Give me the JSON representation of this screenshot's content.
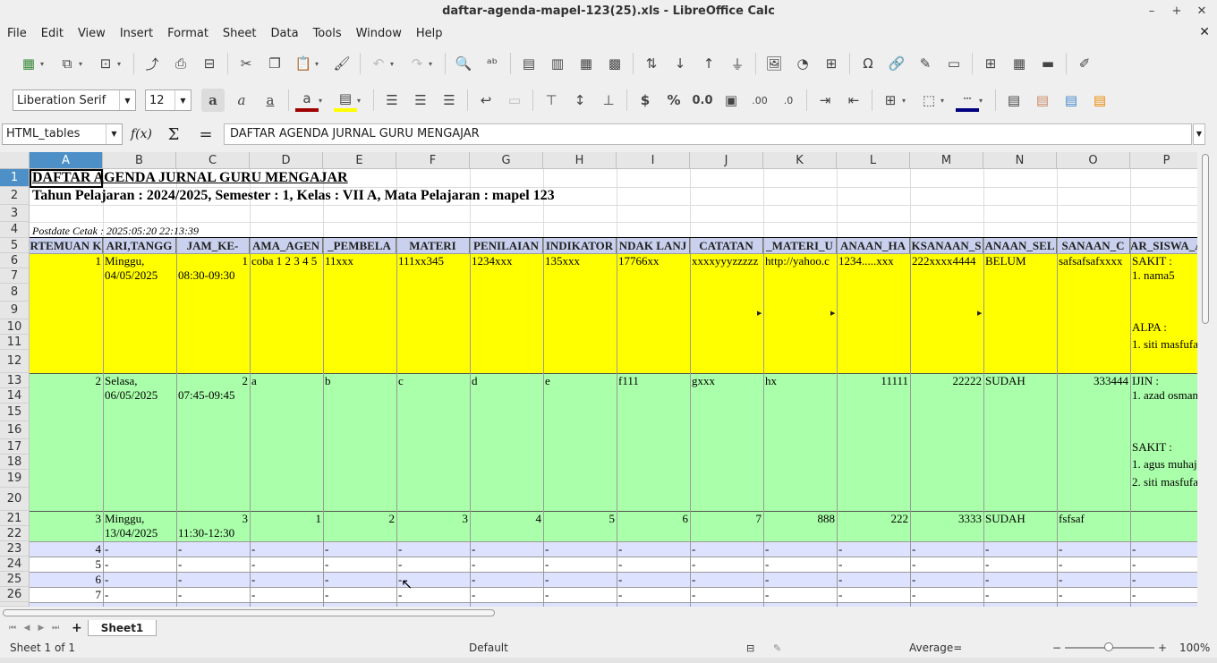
{
  "window": {
    "title": "daftar-agenda-mapel-123(25).xls - LibreOffice Calc"
  },
  "menu": [
    "File",
    "Edit",
    "View",
    "Insert",
    "Format",
    "Sheet",
    "Data",
    "Tools",
    "Window",
    "Help"
  ],
  "format": {
    "font_name": "Liberation Serif",
    "font_size": "12"
  },
  "formula_bar": {
    "name_box": "HTML_tables",
    "content": "DAFTAR AGENDA JURNAL GURU MENGAJAR"
  },
  "columns": [
    "A",
    "B",
    "C",
    "D",
    "E",
    "F",
    "G",
    "H",
    "I",
    "J",
    "K",
    "L",
    "M",
    "N",
    "O",
    "P"
  ],
  "rows": [
    "1",
    "2",
    "3",
    "4",
    "5",
    "6",
    "7",
    "8",
    "9",
    "10",
    "11",
    "12",
    "13",
    "14",
    "15",
    "16",
    "17",
    "18",
    "19",
    "20",
    "21",
    "22",
    "23",
    "24",
    "25",
    "26"
  ],
  "sheet": {
    "title": "DAFTAR AGENDA JURNAL GURU MENGAJAR",
    "subtitle": "Tahun Pelajaran : 2024/2025, Semester : 1, Kelas : VII A, Mata Pelajaran : mapel 123",
    "postdate": "Postdate Cetak : 2025:05:20 22:13:39",
    "headers": [
      "RTEMUAN K",
      "ARI,TANGG",
      "JAM_KE-",
      "AMA_AGEN",
      "_PEMBELA",
      "MATERI",
      "PENILAIAN",
      "INDIKATOR",
      "NDAK LANJ",
      "CATATAN",
      "_MATERI_U",
      "ANAAN_HA",
      "KSANAAN_S",
      "ANAAN_SEL",
      "SANAAN_C",
      "AR_SISWA_A"
    ],
    "entry1": {
      "no": "1",
      "day": "Minggu,",
      "date": "04/05/2025",
      "jam": "1",
      "time": "08:30-09:30",
      "d": "coba 1 2 3 4 5",
      "e": "11xxx",
      "f": "111xx345",
      "g": "1234xxx",
      "h": "135xxx",
      "i": "17766xx",
      "j": "xxxxyyyzzzzz",
      "k": "http://yahoo.c",
      "l": "1234.....xxx",
      "m": "222xxxx4444",
      "n": "BELUM",
      "o": "safsafsafxxxx",
      "p1": "SAKIT :",
      "p2": "1. nama5",
      "p3": "ALPA :",
      "p4": "1. siti masfufa"
    },
    "entry2": {
      "no": "2",
      "day": "Selasa,",
      "date": "06/05/2025",
      "jam": "2",
      "time": "07:45-09:45",
      "d": "a",
      "e": "b",
      "f": "c",
      "g": "d",
      "h": "e",
      "i": "f111",
      "j": "gxxx",
      "k": "hx",
      "l": "11111",
      "m": "22222",
      "n": "SUDAH",
      "o": "333444",
      "p1": "IJIN :",
      "p2": "1. azad osman",
      "p3": "SAKIT :",
      "p4": "1. agus muhaj",
      "p5": "2. siti masfufa"
    },
    "entry3": {
      "no": "3",
      "day": "Minggu,",
      "date": "13/04/2025",
      "jam": "3",
      "time": "11:30-12:30",
      "d": "1",
      "e": "2",
      "f": "3",
      "g": "4",
      "h": "5",
      "i": "6",
      "j": "7",
      "k": "888",
      "l": "222",
      "m": "3333",
      "n": "SUDAH",
      "o": "fsfsaf"
    },
    "empty_rows": [
      "4",
      "5",
      "6",
      "7"
    ],
    "dash": "-"
  },
  "tabs": {
    "sheet1": "Sheet1",
    "add": "+"
  },
  "status": {
    "sheet": "Sheet 1 of 1",
    "style": "Default",
    "average": "Average=",
    "zoom": "100%"
  }
}
